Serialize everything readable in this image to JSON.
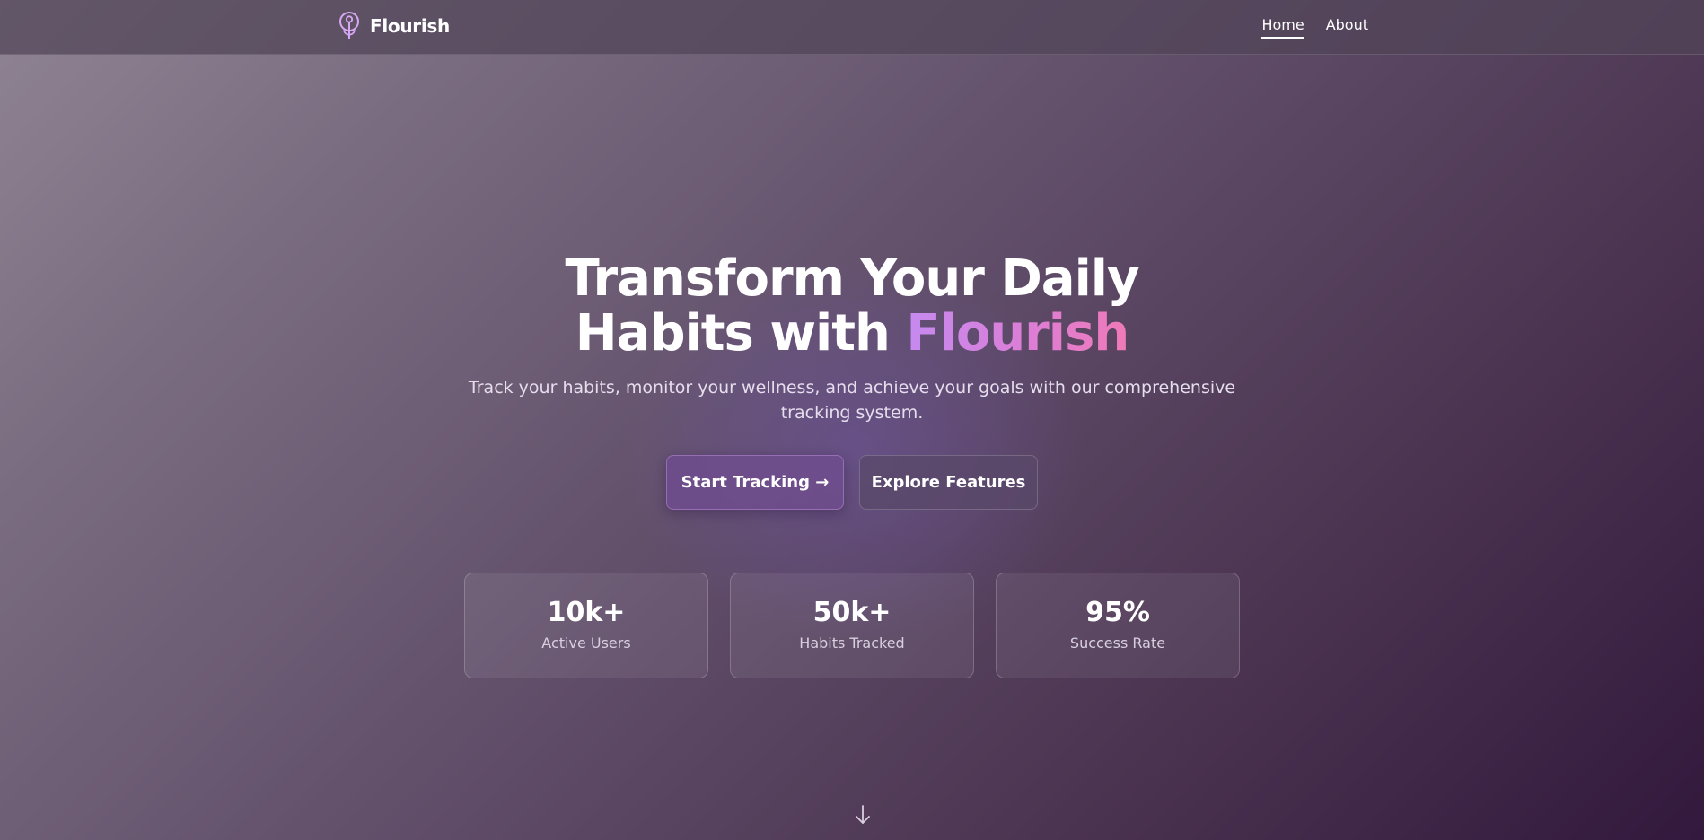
{
  "header": {
    "brand_name": "Flourish",
    "brand_icon": "flower-pin-icon",
    "nav": [
      {
        "label": "Home",
        "active": true
      },
      {
        "label": "About",
        "active": false
      }
    ]
  },
  "hero": {
    "title_line1": "Transform Your Daily",
    "title_line2_prefix": "Habits with ",
    "title_line2_accent": "Flourish",
    "subtitle": "Track your habits, monitor your wellness, and achieve your goals with our comprehensive tracking system.",
    "primary_cta": "Start Tracking →",
    "secondary_cta": "Explore Features"
  },
  "stats": [
    {
      "value": "10k+",
      "label": "Active Users"
    },
    {
      "value": "50k+",
      "label": "Habits Tracked"
    },
    {
      "value": "95%",
      "label": "Success Rate"
    }
  ],
  "scroll_icon": "arrow-down-icon",
  "colors": {
    "accent_start": "#c58af0",
    "accent_end": "#f07ab8",
    "primary_button": "#6e4c8c"
  }
}
